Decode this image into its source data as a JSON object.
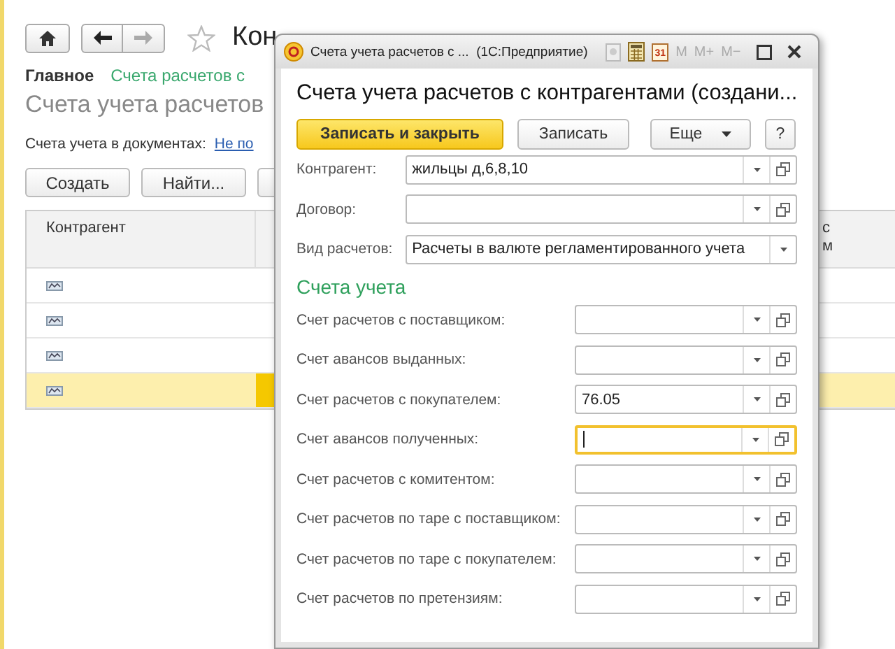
{
  "background": {
    "title": "Кон",
    "nav_section": "Главное",
    "nav_link": "Счета расчетов с",
    "heading": "Счета учета расчетов",
    "doc_accounts_label": "Счета учета в документах:",
    "doc_accounts_link": "Не по",
    "buttons": [
      "Создать",
      "Найти..."
    ],
    "cut_button": true,
    "table": {
      "columns": [
        "Контрагент",
        "с\nм"
      ],
      "rows": [
        {
          "selected": false
        },
        {
          "selected": false
        },
        {
          "selected": false
        },
        {
          "selected": true
        }
      ]
    }
  },
  "dialog": {
    "window_title": "Счета учета расчетов с ...  (1С:Предприятие)",
    "calendar_day": "31",
    "memory_buttons": [
      "M",
      "M+",
      "M−"
    ],
    "heading": "Счета учета расчетов с контрагентами (создани...",
    "primary_button": "Записать и закрыть",
    "save_button": "Записать",
    "more_button": "Еще",
    "help_button": "?",
    "fields": [
      {
        "label": "Контрагент:",
        "value": "жильцы д,6,8,10",
        "kind": "combo",
        "focused": false
      },
      {
        "label": "Договор:",
        "kind": "combo",
        "focused": false
      },
      {
        "label": "Вид расчетов:",
        "value": "Расчеты в валюте регламентированного учета",
        "kind": "select",
        "focused": false
      }
    ],
    "section_title": "Счета учета",
    "accounts": [
      {
        "label": "Счет расчетов с поставщиком:",
        "focused": false
      },
      {
        "label": "Счет авансов выданных:",
        "focused": false
      },
      {
        "label": "Счет расчетов с покупателем:",
        "value": "76.05",
        "focused": false
      },
      {
        "label": "Счет авансов полученных:",
        "focused": true
      },
      {
        "label": "Счет расчетов с комитентом:",
        "focused": false
      },
      {
        "label": "Счет расчетов по таре с поставщиком:",
        "focused": false
      },
      {
        "label": "Счет расчетов по таре с покупателем:",
        "focused": false
      },
      {
        "label": "Счет расчетов по претензиям:",
        "focused": false
      }
    ]
  }
}
